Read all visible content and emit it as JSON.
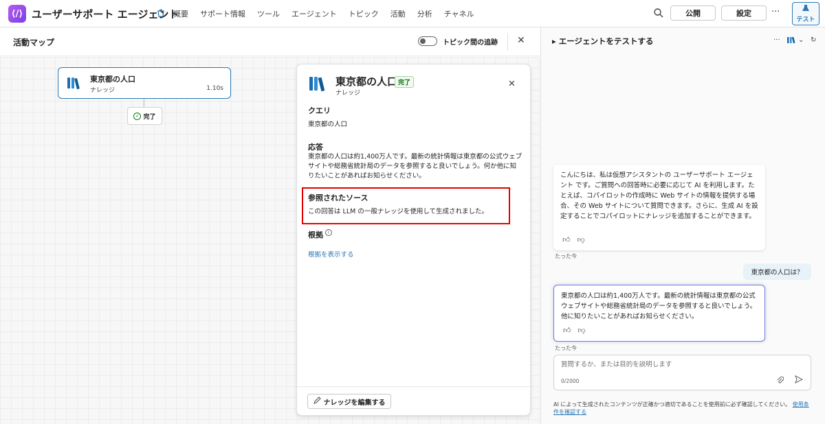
{
  "header": {
    "app_title": "ユーザーサポート エージェント",
    "nav": [
      "概要",
      "サポート情報",
      "ツール",
      "エージェント",
      "トピック",
      "活動",
      "分析",
      "チャネル"
    ],
    "publish_label": "公開",
    "settings_label": "設定",
    "more_label": "···",
    "test_label": "テスト"
  },
  "activity_map": {
    "title": "活動マップ",
    "toggle_label": "トピック間の追跡",
    "node": {
      "title": "東京都の人口",
      "type": "ナレッジ",
      "duration": "1.10s"
    },
    "done_label": "完了"
  },
  "detail": {
    "title": "東京都の人口",
    "status": "完了",
    "subtitle": "ナレッジ",
    "query_heading": "クエリ",
    "query_text": "東京都の人口",
    "response_heading": "応答",
    "response_text": "東京都の人口は約1,400万人です。最新の統計情報は東京都の公式ウェブサイトや総務省統計局のデータを参照すると良いでしょう。何か他に知りたいことがあればお知らせください。",
    "sources_heading": "参照されたソース",
    "sources_text": "この回答は LLM の一般ナレッジを使用して生成されました。",
    "grounding_heading": "根拠",
    "grounding_link": "根拠を表示する",
    "edit_button": "ナレッジを編集する"
  },
  "test_panel": {
    "title": "エージェントをテストする",
    "messages": {
      "bot_greeting": "こんにちは、私は仮想アシスタントの ユーザーサポート エージェント です。ご質問への回答時に必要に応じて AI を利用します。たとえば、コパイロットの作成時に Web サイトの情報を提供する場合、その Web サイトについて質問できます。さらに、生成 AI を設定することでコパイロットにナレッジを追加することができます。",
      "bot_greeting_time": "たった今",
      "user_message": "東京都の人口は？",
      "bot_answer": "東京都の人口は約1,400万人です。最新の統計情報は東京都の公式ウェブサイトや総務省統計局のデータを参照すると良いでしょう。他に知りたいことがあればお知らせください。",
      "bot_answer_time": "たった今"
    },
    "input_placeholder": "質問するか、または目的を説明します",
    "char_count": "0/2000",
    "disclaimer_text": "AI によって生成されたコンテンツが正確かつ適切であることを使用前に必ず確認してください。",
    "disclaimer_link": "使用条件を確認する"
  }
}
